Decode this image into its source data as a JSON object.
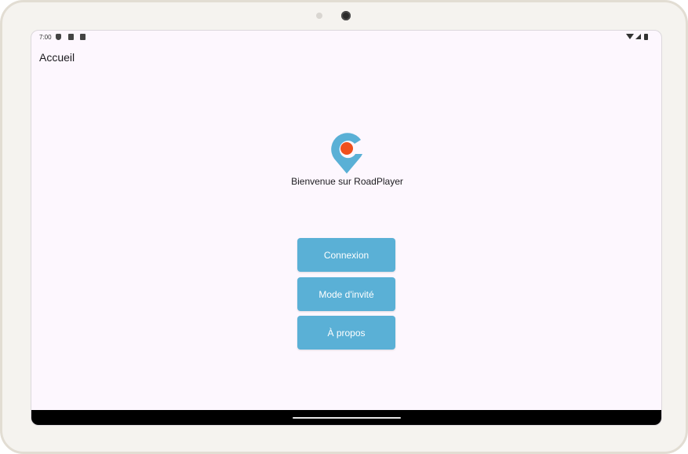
{
  "status_bar": {
    "time": "7:00",
    "icons": [
      "shield-icon",
      "sim-card-icon",
      "notification-icon",
      "wifi-icon",
      "signal-icon",
      "battery-icon"
    ]
  },
  "app_bar": {
    "title": "Accueil"
  },
  "main": {
    "logo": "roadplayer-location-pin-logo",
    "welcome_text": "Bienvenue sur RoadPlayer",
    "buttons": {
      "login": "Connexion",
      "guest": "Mode d'invité",
      "about": "À propos"
    }
  },
  "colors": {
    "background": "#fdf7fe",
    "button": "#5ab0d6",
    "button_text": "#ffffff",
    "logo_blue": "#5ab0d6",
    "logo_orange": "#f0501e"
  }
}
